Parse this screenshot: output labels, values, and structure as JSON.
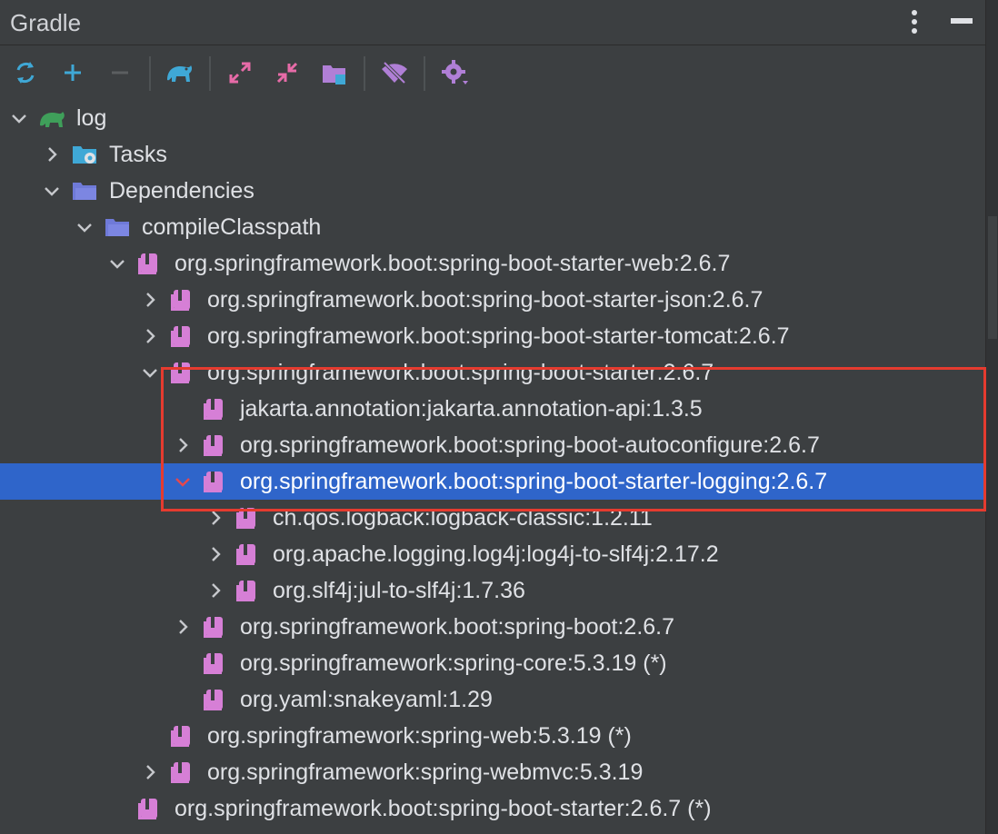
{
  "panel": {
    "title": "Gradle"
  },
  "toolbar": {
    "items": [
      "reload-icon",
      "add-icon",
      "remove-icon",
      "elephant-icon",
      "expand-all-icon",
      "collapse-all-icon",
      "dependencies-icon",
      "offline-mode-icon",
      "settings-icon"
    ]
  },
  "tree": {
    "nodes": [
      {
        "label": "log",
        "level": 0,
        "state": "expanded",
        "icon": "elephant-icon"
      },
      {
        "label": "Tasks",
        "level": 1,
        "state": "collapsed",
        "icon": "tasks-folder-icon"
      },
      {
        "label": "Dependencies",
        "level": 1,
        "state": "expanded",
        "icon": "folder-icon"
      },
      {
        "label": "compileClasspath",
        "level": 2,
        "state": "expanded",
        "icon": "folder-icon"
      },
      {
        "label": "org.springframework.boot:spring-boot-starter-web:2.6.7",
        "level": 3,
        "state": "expanded",
        "icon": "library-icon"
      },
      {
        "label": "org.springframework.boot:spring-boot-starter-json:2.6.7",
        "level": 4,
        "state": "collapsed",
        "icon": "library-icon"
      },
      {
        "label": "org.springframework.boot:spring-boot-starter-tomcat:2.6.7",
        "level": 4,
        "state": "collapsed",
        "icon": "library-icon"
      },
      {
        "label": "org.springframework.boot:spring-boot-starter:2.6.7",
        "level": 4,
        "state": "expanded",
        "icon": "library-icon"
      },
      {
        "label": "jakarta.annotation:jakarta.annotation-api:1.3.5",
        "level": 5,
        "state": "leaf",
        "icon": "library-icon"
      },
      {
        "label": "org.springframework.boot:spring-boot-autoconfigure:2.6.7",
        "level": 5,
        "state": "collapsed",
        "icon": "library-icon"
      },
      {
        "label": "org.springframework.boot:spring-boot-starter-logging:2.6.7",
        "level": 5,
        "state": "expanded",
        "icon": "library-icon",
        "selected": true
      },
      {
        "label": "ch.qos.logback:logback-classic:1.2.11",
        "level": 6,
        "state": "collapsed",
        "icon": "library-icon"
      },
      {
        "label": "org.apache.logging.log4j:log4j-to-slf4j:2.17.2",
        "level": 6,
        "state": "collapsed",
        "icon": "library-icon"
      },
      {
        "label": "org.slf4j:jul-to-slf4j:1.7.36",
        "level": 6,
        "state": "collapsed",
        "icon": "library-icon"
      },
      {
        "label": "org.springframework.boot:spring-boot:2.6.7",
        "level": 5,
        "state": "collapsed",
        "icon": "library-icon"
      },
      {
        "label": "org.springframework:spring-core:5.3.19 (*)",
        "level": 5,
        "state": "leaf",
        "icon": "library-icon"
      },
      {
        "label": "org.yaml:snakeyaml:1.29",
        "level": 5,
        "state": "leaf",
        "icon": "library-icon"
      },
      {
        "label": "org.springframework:spring-web:5.3.19 (*)",
        "level": 4,
        "state": "leaf",
        "icon": "library-icon"
      },
      {
        "label": "org.springframework:spring-webmvc:5.3.19",
        "level": 4,
        "state": "collapsed",
        "icon": "library-icon"
      },
      {
        "label": "org.springframework.boot:spring-boot-starter:2.6.7 (*)",
        "level": 3,
        "state": "leaf",
        "icon": "library-icon"
      }
    ]
  },
  "colors": {
    "background": "#3c3f41",
    "selection": "#2f65ca",
    "highlight_box": "#e53b2f",
    "library_icon": "#d67fd6",
    "folder_icon": "#6f7ad8",
    "elephant_icon": "#3f9f5a"
  }
}
